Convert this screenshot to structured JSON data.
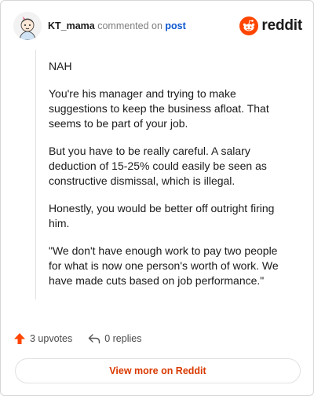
{
  "header": {
    "username": "KT_mama",
    "verb": "commented on",
    "post_link": "post",
    "brand": "reddit"
  },
  "comment": {
    "paragraphs": [
      "NAH",
      "You're his manager and trying to make suggestions to keep the business afloat. That seems to be part of your job.",
      "But you have to be really careful. A salary deduction of 15-25% could easily be seen as constructive dismissal, which is illegal.",
      "Honestly, you would be better off outright firing him.",
      "\"We don't have enough work to pay two people for what is now one person's worth of work. We have made cuts based on job performance.\""
    ]
  },
  "actions": {
    "upvotes_label": "3 upvotes",
    "replies_label": "0 replies"
  },
  "footer": {
    "view_more_label": "View more on Reddit"
  },
  "colors": {
    "accent": "#ff4500",
    "link": "#0b57d0",
    "view_more": "#d93900"
  },
  "icons": {
    "avatar": "avatar-illustration",
    "brand": "reddit-logo-icon",
    "upvote": "upvote-arrow-icon",
    "reply": "reply-arrow-icon"
  }
}
